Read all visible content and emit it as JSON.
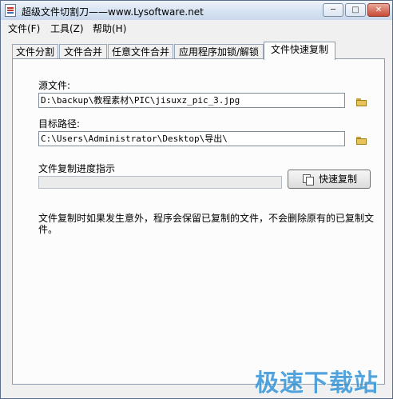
{
  "window": {
    "title": "超级文件切割刀——www.Lysoftware.net",
    "controls": {
      "minimize_icon": "minimize-icon",
      "maximize_icon": "maximize-icon",
      "close_icon": "close-icon"
    }
  },
  "menu": {
    "items": [
      "文件(F)",
      "工具(Z)",
      "帮助(H)"
    ]
  },
  "tabs": [
    {
      "label": "文件分割",
      "active": false
    },
    {
      "label": "文件合并",
      "active": false
    },
    {
      "label": "任意文件合并",
      "active": false
    },
    {
      "label": "应用程序加锁/解锁",
      "active": false
    },
    {
      "label": "文件快速复制",
      "active": true
    }
  ],
  "copy_panel": {
    "source_label": "源文件:",
    "source_value": "D:\\backup\\教程素材\\PIC\\jisuxz_pic_3.jpg",
    "target_label": "目标路径:",
    "target_value": "C:\\Users\\Administrator\\Desktop\\导出\\",
    "progress_label": "文件复制进度指示",
    "progress_fraction": 0,
    "copy_button_label": "快速复制",
    "description": "文件复制时如果发生意外，程序会保留已复制的文件，不会删除原有的已复制文件。"
  },
  "watermark": "极速下载站"
}
